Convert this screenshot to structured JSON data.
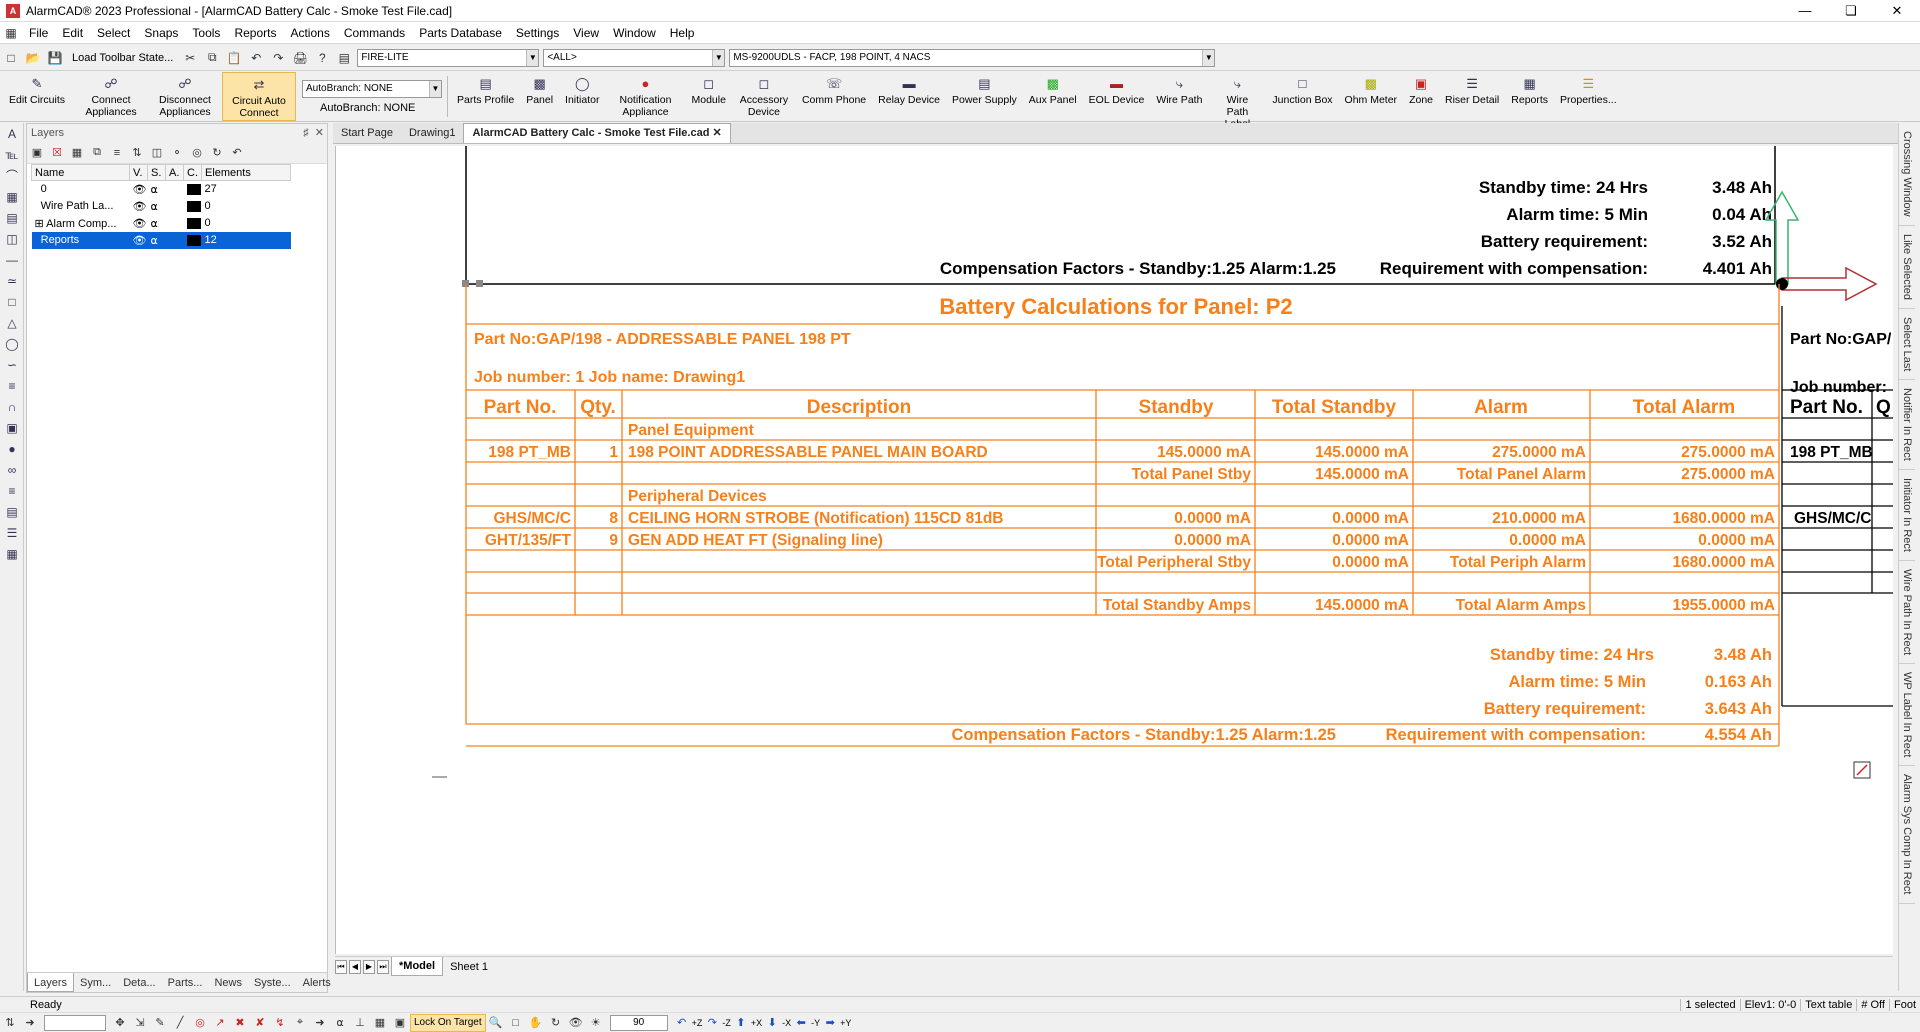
{
  "window": {
    "title": "AlarmCAD® 2023 Professional - [AlarmCAD Battery Calc - Smoke Test File.cad]"
  },
  "menu": [
    "File",
    "Edit",
    "Select",
    "Snaps",
    "Tools",
    "Reports",
    "Actions",
    "Commands",
    "Parts Database",
    "Settings",
    "View",
    "Window",
    "Help"
  ],
  "toolbar1": {
    "load_state": "Load Toolbar State...",
    "manufacturer": "FIRE-LITE",
    "filter": "<ALL>",
    "panel": "MS-9200UDLS - FACP, 198 POINT, 4 NACS"
  },
  "toolbar2": {
    "left": [
      {
        "label": "Edit Circuits",
        "icon": "edit-circuits-icon"
      },
      {
        "label": "Connect Appliances",
        "icon": "connect-icon"
      },
      {
        "label": "Disconnect Appliances",
        "icon": "disconnect-icon"
      },
      {
        "label": "Circuit Auto Connect",
        "icon": "auto-connect-icon",
        "active": true
      }
    ],
    "autobranch_combo": "AutoBranch: NONE",
    "autobranch_label": "AutoBranch: NONE",
    "right": [
      {
        "label": "Parts Profile"
      },
      {
        "label": "Panel"
      },
      {
        "label": "Initiator"
      },
      {
        "label": "Notification Appliance"
      },
      {
        "label": "Module"
      },
      {
        "label": "Accessory Device"
      },
      {
        "label": "Comm Phone"
      },
      {
        "label": "Relay Device"
      },
      {
        "label": "Power Supply"
      },
      {
        "label": "Aux Panel"
      },
      {
        "label": "EOL Device"
      },
      {
        "label": "Wire Path"
      },
      {
        "label": "Wire Path Label"
      },
      {
        "label": "Junction Box"
      },
      {
        "label": "Ohm Meter"
      },
      {
        "label": "Zone"
      },
      {
        "label": "Riser Detail"
      },
      {
        "label": "Reports"
      },
      {
        "label": "Properties..."
      }
    ]
  },
  "layers": {
    "title": "Layers",
    "columns": [
      "Name",
      "V.",
      "S.",
      "A.",
      "C.",
      "Elements"
    ],
    "rows": [
      {
        "name": "0",
        "elements": "27"
      },
      {
        "name": "Wire Path La...",
        "elements": "0"
      },
      {
        "name": "Alarm Comp...",
        "elements": "0"
      },
      {
        "name": "Reports",
        "elements": "12"
      }
    ],
    "tabs": [
      "Layers",
      "Sym...",
      "Deta...",
      "Parts...",
      "News",
      "Syste...",
      "Alerts"
    ]
  },
  "doc_tabs": [
    "Start Page",
    "Drawing1",
    "AlarmCAD Battery Calc - Smoke Test File.cad"
  ],
  "drawing": {
    "top_block": {
      "standby_time": "Standby time: 24 Hrs",
      "standby_ah": "3.48 Ah",
      "alarm_time": "Alarm time: 5 Min",
      "alarm_ah": "0.04 Ah",
      "battery_req": "Battery requirement:",
      "battery_ah": "3.52 Ah",
      "comp": "Compensation Factors - Standby:1.25   Alarm:1.25",
      "req_comp": "Requirement with compensation:",
      "req_ah": "4.401 Ah"
    },
    "title": "Battery Calculations for Panel: P2",
    "part_no": "Part No:GAP/198 - ADDRESSABLE PANEL 198 PT",
    "job": "Job number: 1  Job name: Drawing1",
    "headers": [
      "Part No.",
      "Qty.",
      "Description",
      "Standby",
      "Total Standby",
      "Alarm",
      "Total Alarm"
    ],
    "rows": [
      [
        "",
        "",
        "Panel Equipment",
        "",
        "",
        "",
        ""
      ],
      [
        "198 PT_MB",
        "1",
        "198 POINT ADDRESSABLE PANEL MAIN BOARD",
        "145.0000 mA",
        "145.0000 mA",
        "275.0000 mA",
        "275.0000 mA"
      ],
      [
        "",
        "",
        "",
        "Total Panel Stby",
        "145.0000 mA",
        "Total Panel Alarm",
        "275.0000 mA"
      ],
      [
        "",
        "",
        "Peripheral Devices",
        "",
        "",
        "",
        ""
      ],
      [
        "GHS/MC/C",
        "8",
        "CEILING HORN STROBE (Notification) 115CD 81dB",
        "0.0000 mA",
        "0.0000 mA",
        "210.0000 mA",
        "1680.0000 mA"
      ],
      [
        "GHT/135/FT",
        "9",
        "GEN ADD HEAT FT (Signaling line)",
        "0.0000 mA",
        "0.0000 mA",
        "0.0000 mA",
        "0.0000 mA"
      ],
      [
        "",
        "",
        "",
        "Total Peripheral Stby",
        "0.0000 mA",
        "Total Periph Alarm",
        "1680.0000 mA"
      ],
      [
        "",
        "",
        "",
        "",
        "",
        "",
        ""
      ],
      [
        "",
        "",
        "",
        "Total Standby Amps",
        "145.0000 mA",
        "Total Alarm Amps",
        "1955.0000 mA"
      ]
    ],
    "bottom_block": {
      "standby_time": "Standby time: 24 Hrs",
      "standby_ah": "3.48 Ah",
      "alarm_time": "Alarm time: 5 Min",
      "alarm_ah": "0.163 Ah",
      "battery_req": "Battery requirement:",
      "battery_ah": "3.643 Ah",
      "comp": "Compensation Factors - Standby:1.25   Alarm:1.25",
      "req_comp": "Requirement with compensation:",
      "req_ah": "4.554 Ah"
    },
    "right_block": {
      "part_no": "Part No:GAP/",
      "job": "Job number:",
      "header": "Part No.",
      "header2": "Q",
      "row1": "198 PT_MB",
      "row2": "GHS/MC/C"
    }
  },
  "right_tabs": [
    "Crossing Window",
    "Like Selected",
    "Select Last",
    "Notifier In Rect",
    "Initiator In Rect",
    "Wire Path In Rect",
    "WP Label In Rect",
    "Alarm Sys Comp In Rect"
  ],
  "sheet_tabs": [
    "*Model",
    "Sheet 1"
  ],
  "status": {
    "left": "Ready",
    "selected": "1 selected",
    "elev": "Elev1: 0'-0",
    "text": "Text table",
    "off": "# Off",
    "foot": "Foot"
  },
  "bottom_toolbar": {
    "lock_on_target": "Lock On Target",
    "angle": "90",
    "axes": [
      "+Z",
      "-Z",
      "+X",
      "-X",
      "-Y",
      "+Y"
    ]
  },
  "colors": {
    "orange": "#f7801a",
    "black": "#000000",
    "selection": "#0a64d8",
    "arrow_green": "#3cb371",
    "arrow_red": "#b03030"
  }
}
